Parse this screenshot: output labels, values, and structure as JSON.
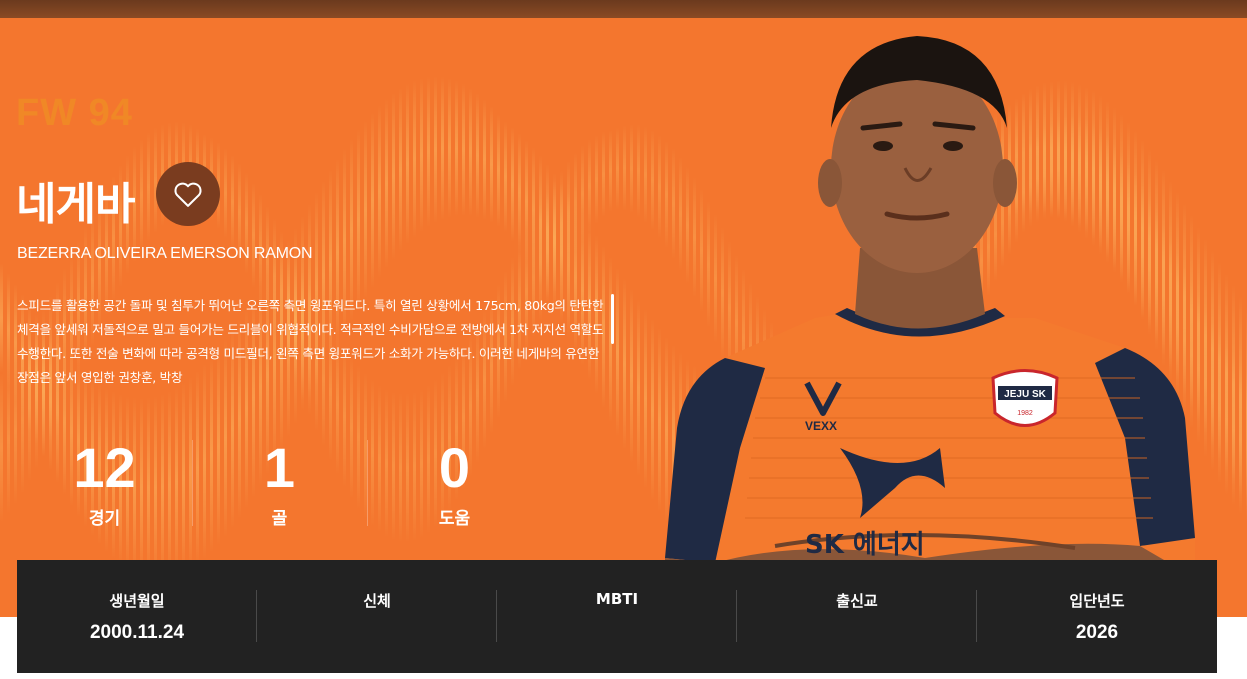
{
  "player": {
    "position_number": "FW 94",
    "name_ko": "네게바",
    "name_en": "BEZERRA OLIVEIRA EMERSON RAMON",
    "description": "스피드를 활용한 공간 돌파 및 침투가 뛰어난 오른쪽 측면 윙포워드다. 특히 열린 상황에서 175cm, 80kg의 탄탄한 체격을 앞세워 저돌적으로 밀고 들어가는 드리블이 위협적이다. 적극적인 수비가담으로 전방에서 1차 저지선 역할도 수행한다. 또한 전술 변화에 따라 공격형 미드필더, 왼쪽 측면 윙포워드가 소화가 가능하다. 이러한 네게바의 유연한 장점은 앞서 영입한 권창훈, 박창"
  },
  "stats": [
    {
      "value": "12",
      "label": "경기"
    },
    {
      "value": "1",
      "label": "골"
    },
    {
      "value": "0",
      "label": "도움"
    }
  ],
  "info": [
    {
      "label": "생년월일",
      "value": "2000.11.24"
    },
    {
      "label": "신체",
      "value": ""
    },
    {
      "label": "MBTI",
      "value": ""
    },
    {
      "label": "출신교",
      "value": ""
    },
    {
      "label": "입단년도",
      "value": "2026"
    }
  ],
  "jersey": {
    "brand": "VEXX",
    "club_badge": "JEJU SK",
    "badge_year": "1982",
    "sponsor": "SK 에너지"
  },
  "icons": {
    "favorite": "heart-outline-icon"
  },
  "colors": {
    "hero_bg": "#f4762e",
    "accent_dark": "#7a3c1f",
    "info_bar_bg": "#222222",
    "jersey_orange": "#f47a2e",
    "jersey_navy": "#1f2a44"
  }
}
